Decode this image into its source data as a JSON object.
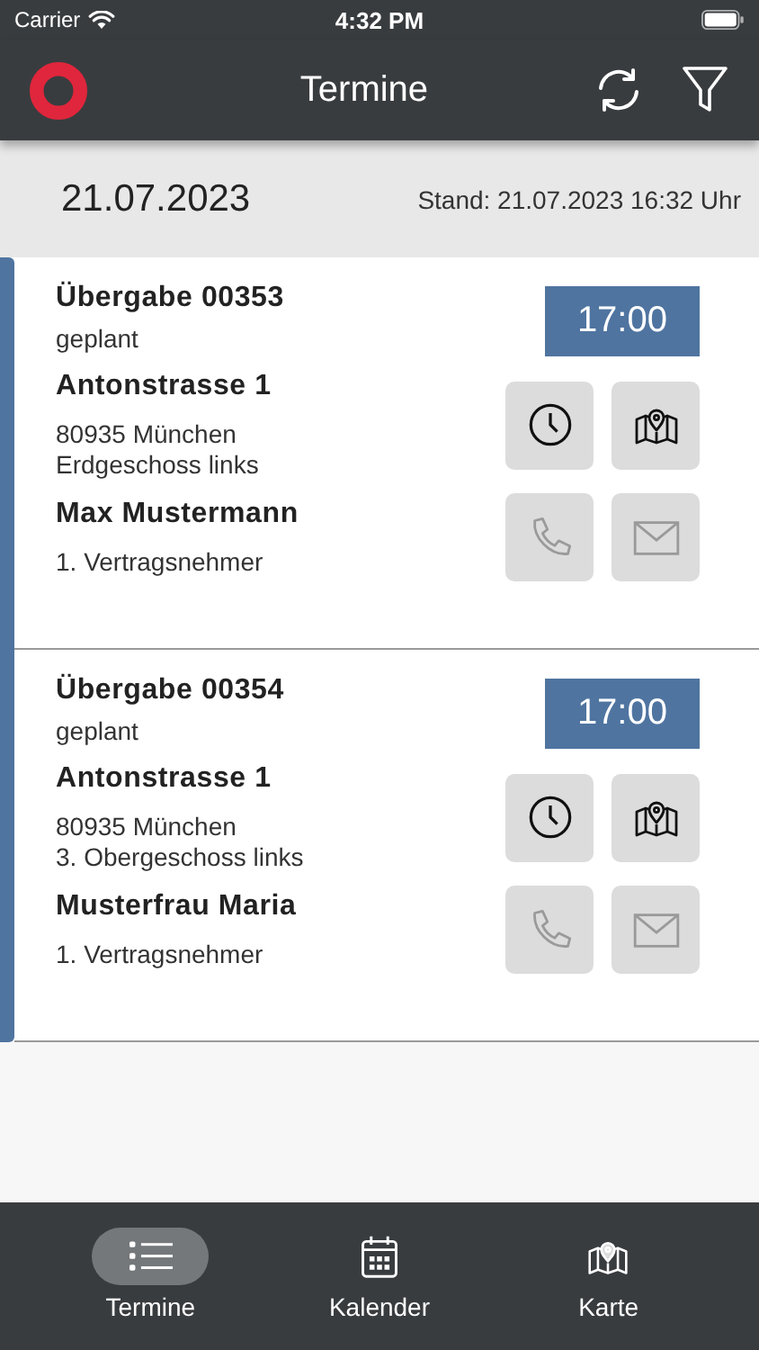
{
  "status_bar": {
    "carrier": "Carrier",
    "time": "4:32 PM"
  },
  "header": {
    "title": "Termine"
  },
  "date_bar": {
    "date": "21.07.2023",
    "updated": "Stand: 21.07.2023 16:32 Uhr"
  },
  "appointments": [
    {
      "title": "Übergabe 00353",
      "status": "geplant",
      "time": "17:00",
      "street": "Antonstrasse 1",
      "city": "80935 München",
      "floor": "Erdgeschoss links",
      "contact": "Max Mustermann",
      "role": "1. Vertragsnehmer",
      "actions": [
        {
          "kind": "clock",
          "disabled": false
        },
        {
          "kind": "map",
          "disabled": false
        },
        {
          "kind": "phone",
          "disabled": true
        },
        {
          "kind": "mail",
          "disabled": true
        }
      ]
    },
    {
      "title": "Übergabe 00354",
      "status": "geplant",
      "time": "17:00",
      "street": "Antonstrasse 1",
      "city": "80935 München",
      "floor": "3. Obergeschoss links",
      "contact": "Musterfrau Maria",
      "role": "1. Vertragsnehmer",
      "actions": [
        {
          "kind": "clock",
          "disabled": false
        },
        {
          "kind": "map",
          "disabled": false
        },
        {
          "kind": "phone",
          "disabled": true
        },
        {
          "kind": "mail",
          "disabled": true
        }
      ]
    }
  ],
  "tabs": [
    {
      "label": "Termine",
      "kind": "list",
      "selected": true
    },
    {
      "label": "Kalender",
      "kind": "calendar",
      "selected": false
    },
    {
      "label": "Karte",
      "kind": "map",
      "selected": false
    }
  ]
}
